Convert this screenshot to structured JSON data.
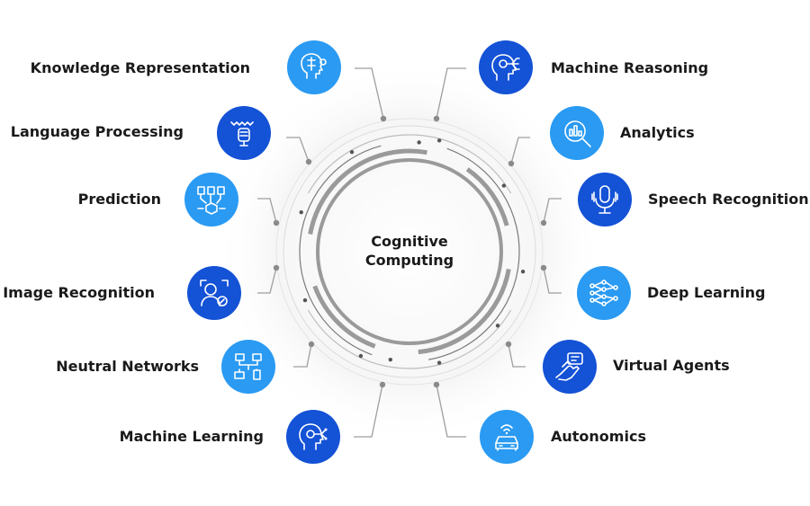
{
  "center": {
    "line1": "Cognitive",
    "line2": "Computing"
  },
  "colors": {
    "dark_blue": "#1452d6",
    "light_blue": "#2a9af2",
    "ring_gray": "#9a9a9a",
    "line_gray": "#9e9e9e"
  },
  "left_items": [
    {
      "label": "Knowledge Representation",
      "icon": "brain-head-icon",
      "tone": "light"
    },
    {
      "label": "Language Processing",
      "icon": "voice-wave-icon",
      "tone": "dark"
    },
    {
      "label": "Prediction",
      "icon": "network-cube-icon",
      "tone": "light"
    },
    {
      "label": "Image Recognition",
      "icon": "face-scan-icon",
      "tone": "dark"
    },
    {
      "label": "Neutral Networks",
      "icon": "network-devices-icon",
      "tone": "light"
    },
    {
      "label": "Machine Learning",
      "icon": "ai-head-icon",
      "tone": "dark"
    }
  ],
  "right_items": [
    {
      "label": "Machine Reasoning",
      "icon": "reasoning-head-icon",
      "tone": "dark"
    },
    {
      "label": "Analytics",
      "icon": "magnifier-chart-icon",
      "tone": "light"
    },
    {
      "label": "Speech Recognition",
      "icon": "microphone-icon",
      "tone": "dark"
    },
    {
      "label": "Deep Learning",
      "icon": "neural-layers-icon",
      "tone": "light"
    },
    {
      "label": "Virtual Agents",
      "icon": "touch-hand-icon",
      "tone": "dark"
    },
    {
      "label": "Autonomics",
      "icon": "autonomous-car-icon",
      "tone": "light"
    }
  ]
}
